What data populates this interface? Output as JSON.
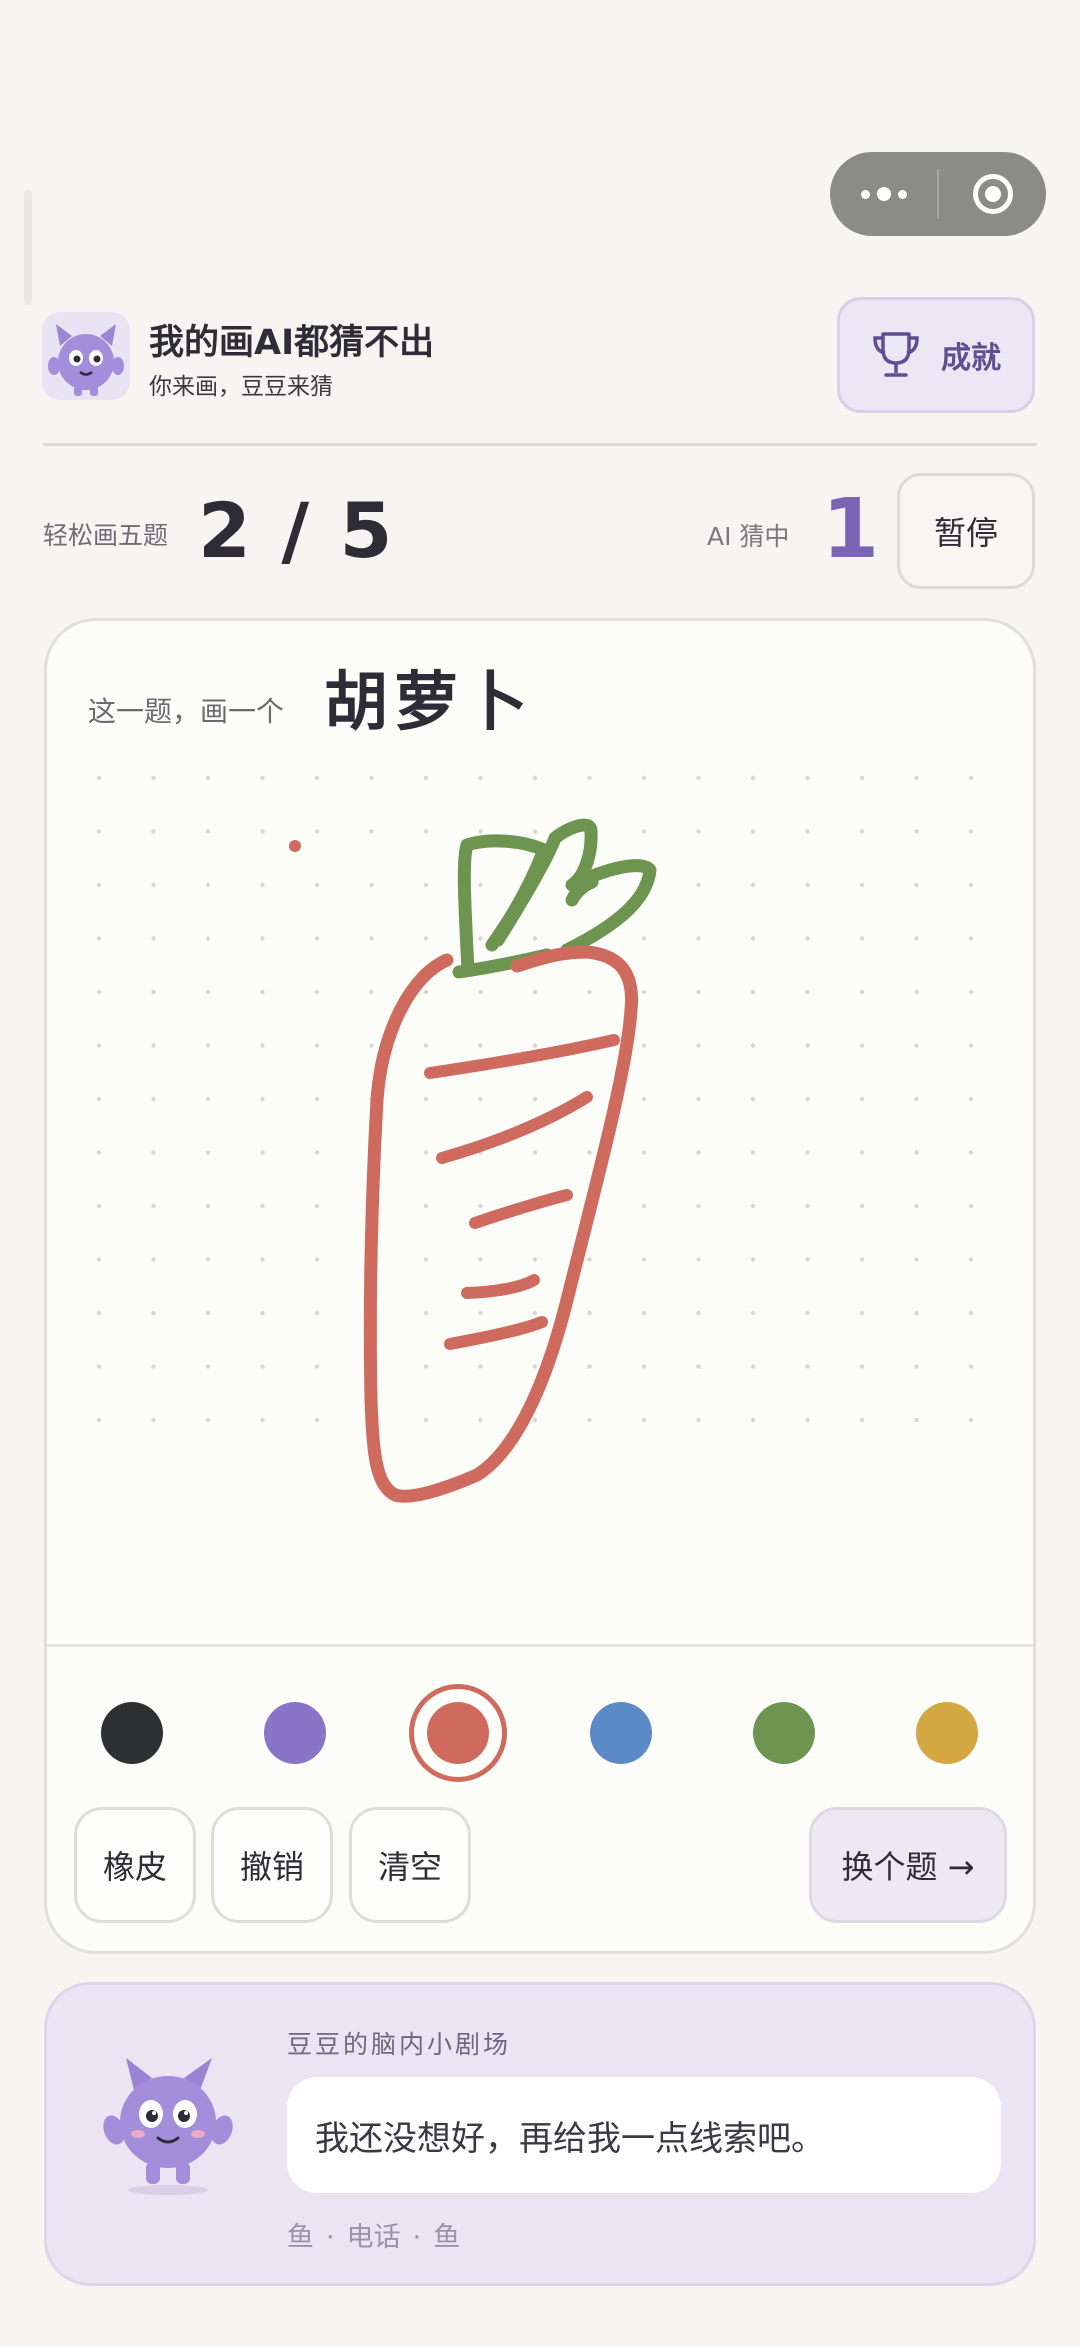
{
  "app": {
    "title": "我的画AI都猜不出",
    "subtitle": "你来画，豆豆来猜",
    "achievements_label": "成就"
  },
  "game": {
    "level_label": "轻松画五题",
    "progress": "2 / 5",
    "ai_guessed_label": "AI 猜中",
    "ai_guessed_count": "1",
    "pause_label": "暂停"
  },
  "prompt": {
    "label": "这一题，画一个",
    "word": "胡萝卜"
  },
  "palette": {
    "colors": [
      "#2f3033",
      "#8a74c8",
      "#cf6a5e",
      "#5b8ac7",
      "#6e9550",
      "#d3a843"
    ],
    "selected_color": "#cf6a5e"
  },
  "tools": {
    "eraser": "橡皮",
    "undo": "撤销",
    "clear": "清空",
    "next": "换个题 →"
  },
  "thought": {
    "title": "豆豆的脑内小剧场",
    "message": "我还没想好，再给我一点线索吧。",
    "hints": [
      "鱼",
      "电话",
      "鱼"
    ]
  },
  "icons": [
    "more-dots-icon",
    "close-target-icon",
    "mascot-avatar-icon",
    "trophy-icon"
  ]
}
